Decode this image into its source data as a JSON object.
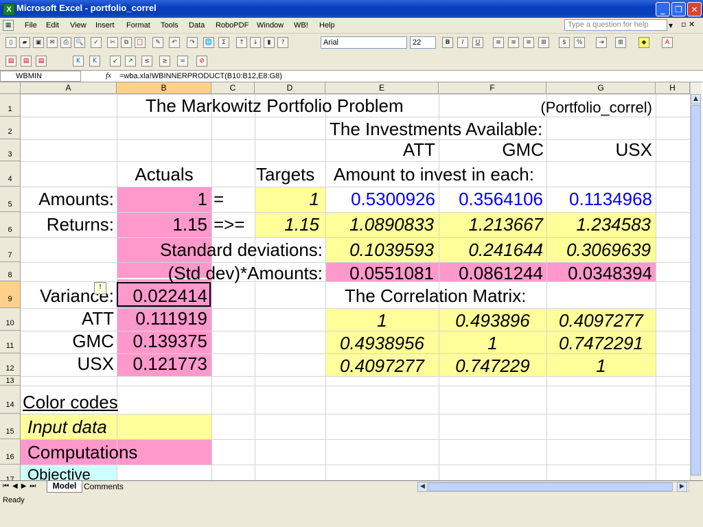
{
  "window": {
    "title": "Microsoft Excel - portfolio_correl"
  },
  "menu": [
    "File",
    "Edit",
    "View",
    "Insert",
    "Format",
    "Tools",
    "Data",
    "RoboPDF",
    "Window",
    "WB!",
    "Help"
  ],
  "help_placeholder": "Type a question for help",
  "toolbar": {
    "font": "Arial",
    "size": "22"
  },
  "formula_bar": {
    "name_box": "WBMIN",
    "fx": "fx",
    "formula": "=wba.xla!WBINNERPRODUCT(B10:B12,E8:G8)"
  },
  "columns": [
    "A",
    "B",
    "C",
    "D",
    "E",
    "F",
    "G",
    "H"
  ],
  "rows": [
    "1",
    "2",
    "3",
    "4",
    "5",
    "6",
    "7",
    "8",
    "9",
    "10",
    "11",
    "12",
    "13",
    "14",
    "15",
    "16",
    "17"
  ],
  "sheet": {
    "title": "The Markowitz Portfolio Problem",
    "file_tag": "(Portfolio_correl)",
    "investments_label": "The Investments Available:",
    "assets": [
      "ATT",
      "GMC",
      "USX"
    ],
    "actuals": "Actuals",
    "targets": "Targets",
    "amount_label": "Amount to invest in each:",
    "amounts_label": "Amounts:",
    "amounts_actual": "1",
    "amounts_op": "=",
    "amounts_target": "1",
    "amounts": [
      "0.5300926",
      "0.3564106",
      "0.1134968"
    ],
    "returns_label": "Returns:",
    "returns_actual": "1.15",
    "returns_op": "=>=",
    "returns_target": "1.15",
    "returns": [
      "1.0890833",
      "1.213667",
      "1.234583"
    ],
    "stddev_label": "Standard deviations:",
    "stddevs": [
      "0.1039593",
      "0.241644",
      "0.3069639"
    ],
    "stdamt_label": "(Std dev)*Amounts:",
    "stdamts": [
      "0.0551081",
      "0.0861244",
      "0.0348394"
    ],
    "variance_label": "Variance:",
    "variance": "0.022414",
    "corr_label": "The Correlation Matrix:",
    "asset_rows": [
      {
        "name": "ATT",
        "value": "0.111919",
        "corr": [
          "1",
          "0.493896",
          "0.4097277"
        ]
      },
      {
        "name": "GMC",
        "value": "0.139375",
        "corr": [
          "0.4938956",
          "1",
          "0.7472291"
        ]
      },
      {
        "name": "USX",
        "value": "0.121773",
        "corr": [
          "0.4097277",
          "0.747229",
          "1"
        ]
      }
    ],
    "color_codes": "Color codes",
    "input_data": "Input data",
    "computations": "Computations",
    "objective": "Objective"
  },
  "tabs": [
    "Model",
    "Comments"
  ],
  "status": "Ready",
  "colors": {
    "yellow": "#ffff99",
    "pink": "#ff99cc",
    "cyan": "#ccffff",
    "titlebar": "#0a3ec0"
  }
}
